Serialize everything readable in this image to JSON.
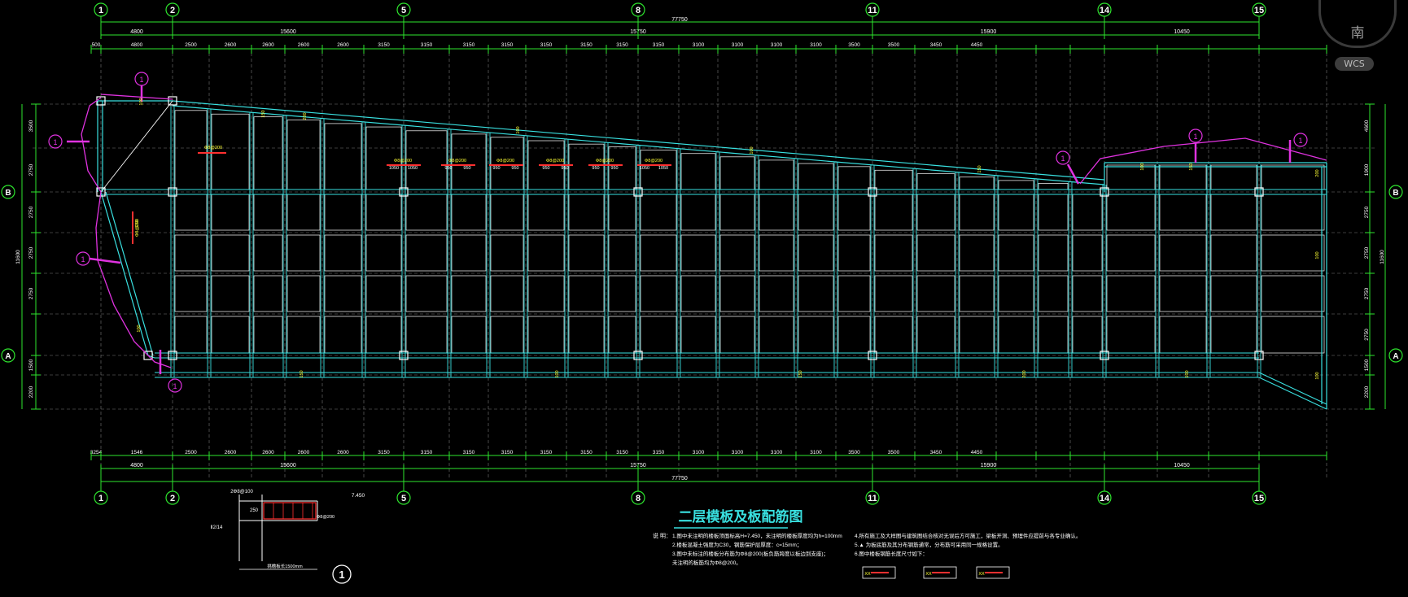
{
  "viewcube": {
    "direction_label": "南",
    "wcs_label": "WCS"
  },
  "drawing": {
    "title": "二层模板及板配筋图",
    "column_axes": [
      "1",
      "2",
      "5",
      "8",
      "11",
      "14",
      "15"
    ],
    "row_axes": [
      "A",
      "B"
    ],
    "total_length": "77750",
    "top_segments_lvl1": [
      "4800",
      "15600",
      "15750",
      "15900",
      "10450"
    ],
    "top_segments_lvl2": [
      "500",
      "4800",
      "2500",
      "2600",
      "2600",
      "2600",
      "2600",
      "3150",
      "3150",
      "3150",
      "3150",
      "3150",
      "3150",
      "3150",
      "3150",
      "3100",
      "3100",
      "3100",
      "3100",
      "3500",
      "3500",
      "3450",
      "4450"
    ],
    "bottom_segments_lvl1": [
      "4800",
      "15600",
      "15750",
      "15900",
      "10450"
    ],
    "bottom_segments_lvl2": [
      "3254",
      "1546",
      "2500",
      "2600",
      "2600",
      "2600",
      "2600",
      "3150",
      "3150",
      "3150",
      "3150",
      "3150",
      "3150",
      "3150",
      "3150",
      "3100",
      "3100",
      "3100",
      "3100",
      "3500",
      "3500",
      "3450",
      "4450"
    ],
    "left_dims": [
      "3500",
      "2750",
      "2750",
      "2750",
      "2750",
      "1500",
      "2200"
    ],
    "left_total": "11600",
    "right_dims": [
      "4600",
      "1900",
      "2750",
      "2750",
      "2750",
      "2750",
      "1500",
      "2200"
    ],
    "right_total": "11600",
    "rebar_tags_red": [
      "1050",
      "1050",
      "950",
      "950",
      "950",
      "950",
      "950",
      "950",
      "950",
      "950",
      "1050",
      "1050"
    ],
    "rebar_marks": [
      "Φ8@200",
      "Φ8@200",
      "Φ8@200",
      "Φ8@200",
      "Φ8@200",
      "Φ8@200"
    ],
    "slab_marks": [
      "100",
      "150",
      "200",
      "100",
      "100",
      "150"
    ],
    "section_callouts": [
      "1",
      "1",
      "1",
      "1",
      "1"
    ],
    "detail_ref": "1",
    "detail_labels": {
      "top_rebar": "2Φ8@100",
      "level": "7.450",
      "width": "250",
      "side_rebar": "Φ8@200",
      "bottom_note": "挑檐板长1500mm",
      "left_note": "Ⅱ2/14"
    },
    "notes_heading": "说 明：",
    "notes": [
      "1.图中未注明的楼板顶面标高H=7.450，未注明的楼板厚度均为h=100mm",
      "2.楼板混凝土强度为C30，钢筋保护层厚度：c=15mm；",
      "3.图中未标注的楼板分布筋为Φ8@200(板负筋跨度以板边到支座)；",
      "未注明的板筋均为Φ8@200。",
      "4.所有施工及大样图与建筑图结合核对无误后方可施工，梁板开洞、预埋件应提前与各专业确认。",
      "5.▲ 为板底筋及其分布钢筋通常，分布筋可采用同一规格设置。",
      "6.图中楼板钢筋长度尺寸如下："
    ],
    "legend_tags": [
      "XX",
      "XX",
      "XX"
    ]
  }
}
